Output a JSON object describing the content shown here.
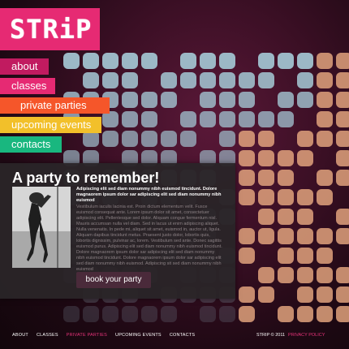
{
  "logo": {
    "text": "STRiP"
  },
  "nav": [
    {
      "label": "about",
      "color": "#c11b60"
    },
    {
      "label": "classes",
      "color": "#e62a73"
    },
    {
      "label": "private parties",
      "color": "#f5562a"
    },
    {
      "label": "upcoming events",
      "color": "#f2c02a"
    },
    {
      "label": "contacts",
      "color": "#19b77f"
    }
  ],
  "panel": {
    "title": "A party to remember!",
    "intro": "Adipiscing elit sed diam nonummy nibh euismod tincidunt. Dolore magnaorem ipsum dolor sar adipiscing elit sed diam nonummy nibh euismod",
    "body": "Vestibulum iaculis lacinia est. Proin dictum elementum velit. Fusce euismod consequat ante. Lorem ipsum dolor sit amet, consectetuer adipiscing elit. Pellentesque sed dolor. Aliquam congue fermentum nisl. Mauris accumsan nulla vel diam. Sed in lacus ut enim adipiscing aliquet. Nulla venenatis. In pede mi, aliquet sit amet, euismod in, auctor ut, ligula. Aliquam dapibus tincidunt metus. Praesent justo dolor, lobortis quis, lobortis dignissim, pulvinar ac, lorem. Vestibulum sed ante. Donec sagittis euismod purus. Adipiscing elit sed diam nonummy nibh euismod tincidunt. Dolore magnaorem ipsum dolor sar adipiscing elit sed diam nonummy nibh euismod tincidunt. Dolore magnaorem ipsum dolor sar adipiscing elit sed diam nonummy nibh euismod. Adipiscing sit sed diam nonummy nibh euismod",
    "cta": "book your party"
  },
  "footer": {
    "links": [
      {
        "label": "ABOUT",
        "active": false
      },
      {
        "label": "CLASSES",
        "active": false
      },
      {
        "label": "PRIVATE PARTIES",
        "active": true
      },
      {
        "label": "UPCOMING EVENTS",
        "active": false
      },
      {
        "label": "CONTACTS",
        "active": false
      }
    ],
    "copyright": "STRIP © 2011",
    "policy": "PRIVACY POLICY"
  },
  "colors": {
    "accent": "#e62a73",
    "dot_blue": "#9cb8c6",
    "dot_peach": "#e0a27c"
  }
}
